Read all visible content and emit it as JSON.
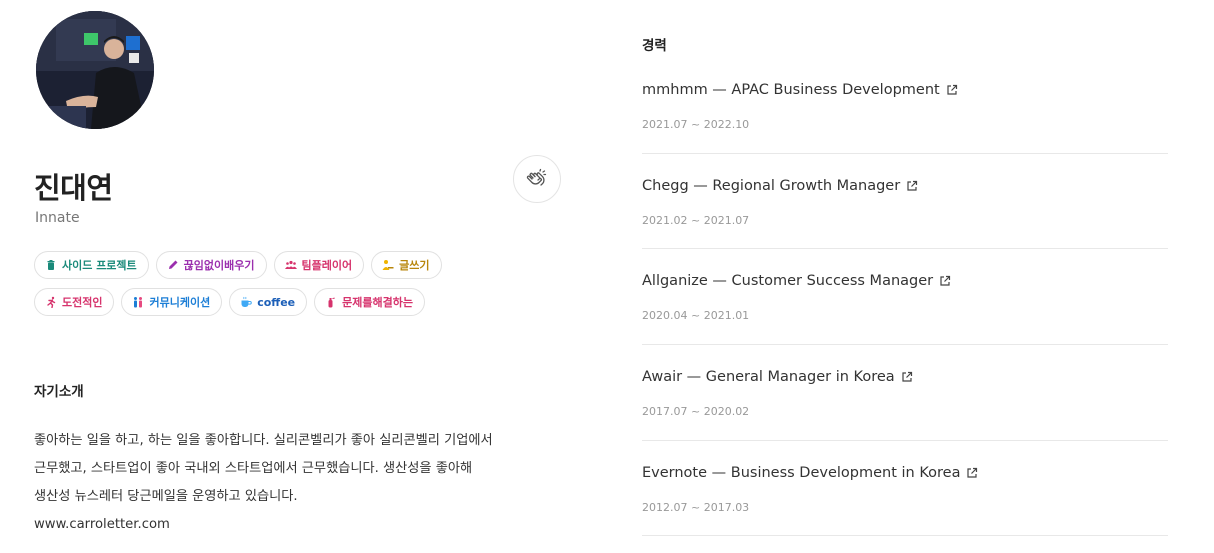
{
  "profile": {
    "name": "진대연",
    "subtitle": "Innate"
  },
  "tags": [
    {
      "label": "사이드 프로젝트",
      "icon": "trash-can-icon",
      "color": "#1a8a7a"
    },
    {
      "label": "끊임없이배우기",
      "icon": "pencil-icon",
      "color": "#9b2fae"
    },
    {
      "label": "팀플레이어",
      "icon": "team-icon",
      "color": "#d6336c"
    },
    {
      "label": "글쓰기",
      "icon": "writing-person-icon",
      "color": "#b8860b"
    },
    {
      "label": "도전적인",
      "icon": "runner-icon",
      "color": "#d6336c"
    },
    {
      "label": "커뮤니케이션",
      "icon": "people-icon",
      "color": "#1c7ed6"
    },
    {
      "label": "coffee",
      "icon": "coffee-icon",
      "color": "#1c5fb8"
    },
    {
      "label": "문제를해결하는",
      "icon": "fire-extinguisher-icon",
      "color": "#d6336c"
    }
  ],
  "intro": {
    "title": "자기소개",
    "lines": [
      "좋아하는 일을 하고, 하는 일을 좋아합니다. 실리콘벨리가 좋아 실리콘벨리 기업에서",
      "근무했고, 스타트업이 좋아 국내외 스타트업에서 근무했습니다. 생산성을 좋아해",
      "생산성 뉴스레터 당근메일을 운영하고 있습니다.",
      "www.carroletter.com"
    ]
  },
  "career": {
    "title": "경력",
    "items": [
      {
        "role": "mmhmm — APAC Business Development",
        "period": "2021.07 ~ 2022.10"
      },
      {
        "role": "Chegg — Regional Growth Manager",
        "period": "2021.02 ~ 2021.07"
      },
      {
        "role": "Allganize — Customer Success Manager",
        "period": "2020.04 ~ 2021.01"
      },
      {
        "role": "Awair — General Manager in Korea",
        "period": "2017.07 ~ 2020.02"
      },
      {
        "role": "Evernote — Business Development in Korea",
        "period": "2012.07 ~ 2017.03"
      }
    ]
  }
}
